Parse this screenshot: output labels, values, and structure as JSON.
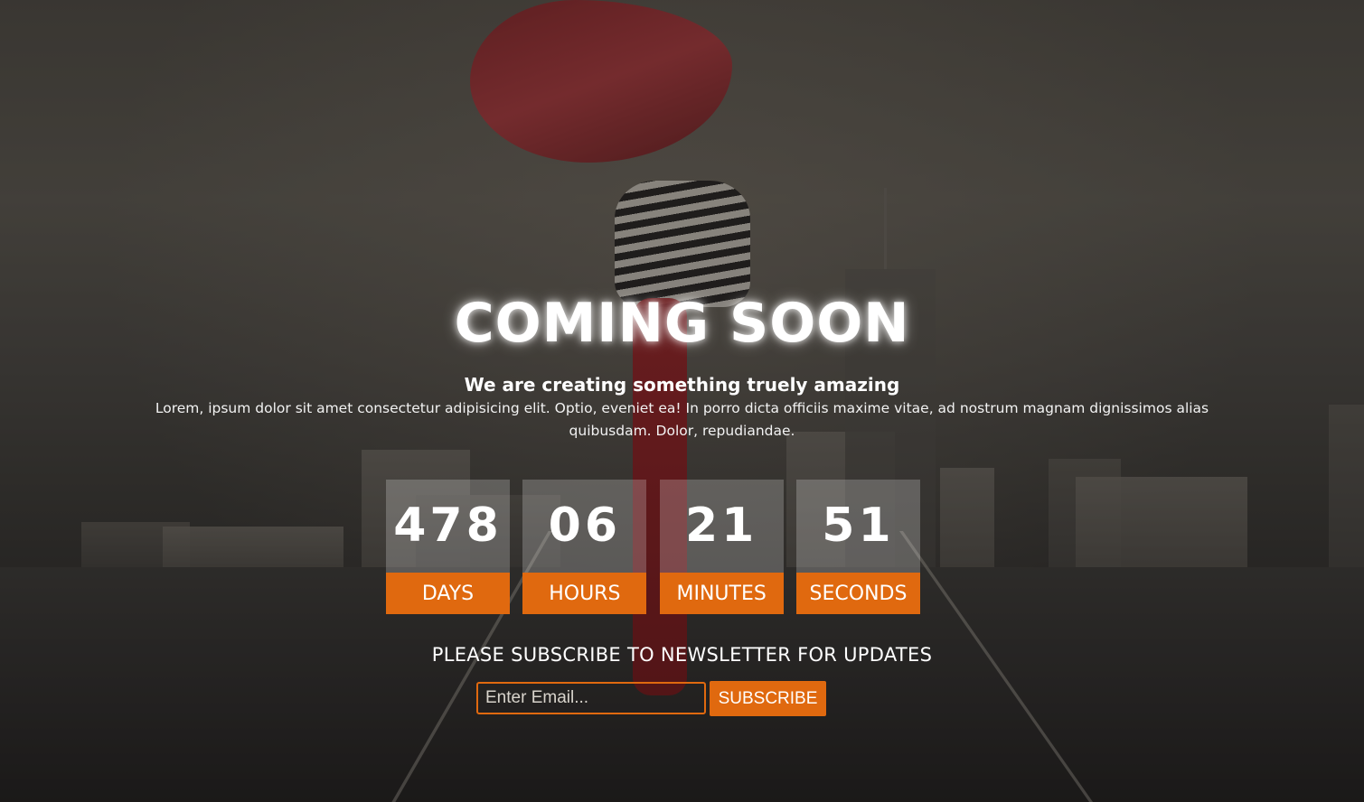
{
  "hero": {
    "title": "COMING SOON",
    "subtitle": "We are creating something truely amazing",
    "description": "Lorem, ipsum dolor sit amet consectetur adipisicing elit. Optio, eveniet ea! In porro dicta officiis maxime vitae, ad nostrum magnam dignissimos alias quibusdam. Dolor, repudiandae."
  },
  "countdown": {
    "days": {
      "value": "478",
      "label": "DAYS"
    },
    "hours": {
      "value": "06",
      "label": "HOURS"
    },
    "minutes": {
      "value": "21",
      "label": "MINUTES"
    },
    "seconds": {
      "value": "51",
      "label": "SECONDS"
    }
  },
  "newsletter": {
    "heading": "PLEASE SUBSCRIBE TO NEWSLETTER FOR UPDATES",
    "email_placeholder": "Enter Email...",
    "email_value": "",
    "button_label": "SUBSCRIBE"
  },
  "colors": {
    "accent": "#e0690f",
    "text": "#ffffff"
  }
}
